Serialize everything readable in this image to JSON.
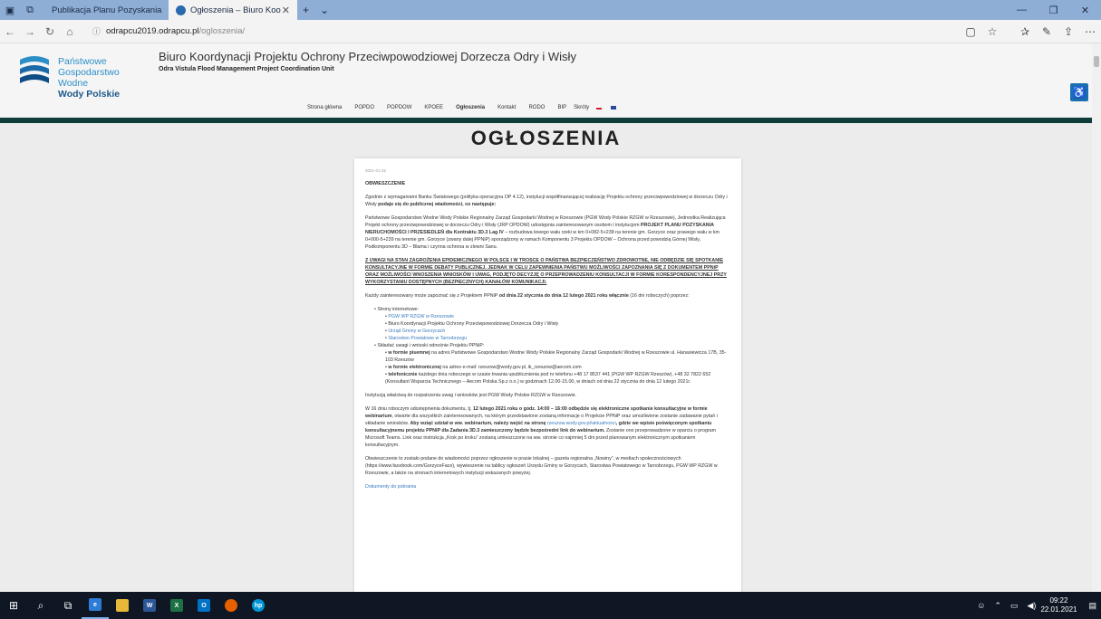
{
  "browser": {
    "tabs": [
      {
        "title": "Publikacja Planu Pozyskania",
        "active": false
      },
      {
        "title": "Ogłoszenia – Biuro Koo",
        "active": true
      }
    ],
    "url_domain": "odrapcu2019.odrapcu.pl",
    "url_path": "/ogloszenia/"
  },
  "site": {
    "logo_line1": "Państwowe",
    "logo_line2": "Gospodarstwo Wodne",
    "logo_line3": "Wody Polskie",
    "title": "Biuro Koordynacji Projektu Ochrony Przeciwpowodziowej Dorzecza Odry i Wisły",
    "subtitle": "Odra Vistula Flood Management Project Coordination Unit",
    "nav": [
      "Strona główna",
      "POPDO",
      "POPDOW",
      "KPOEE",
      "Ogłoszenia",
      "Kontakt",
      "RODO",
      "BIP",
      "Skróty"
    ],
    "heading": "OGŁOSZENIA"
  },
  "article": {
    "date": "2021-01-22",
    "header": "OBWIESZCZENIE",
    "p1": "Zgodnie z wymaganiami Banku Światowego (polityka operacyjna OP 4.12), instytucji współfinansującej realizację Projektu ochrony przeciwpowodziowej w dorzeczu Odry i Wisły ",
    "p1b": "podaje się do publicznej wiadomości, co następuje:",
    "p2": "Państwowe Gospodarstwo Wodne Wody Polskie Regionalny Zarząd Gospodarki Wodnej w Rzeszowie (PGW Wody Polskie RZGW w Rzeszowie), Jednostka Realizująca Projekt ochrony przeciwpowodziowej w dorzeczu Odry i Wisły (JRP OPDOW) udostępnia zainteresowanym osobom i instytucjom ",
    "p2b": "PROJEKT PLANU POZYSKANIA NIERUCHOMOŚCI I PRZESIEDLEŃ dla Kontraktu 3D.3 Lag IV",
    "p2c": " – rozbudowa lewego wału rzeki w km 0+082-5+238 na terenie gm. Gorzyce oraz prawego wału w km 0+000-5+239 na terenie gm. Gorzyce (zwany dalej PPNiP) sporządzony w ramach Komponentu 3 Projektu OPDOW – Ochrona przed powodzią Górnej Wisły, Podkomponentu 3D – Blama i czynna ochrona w zlewni Sanu.",
    "p3": "Z UWAGI NA STAN ZAGROŻENIA EPIDEMICZNEGO W POLSCE I W TROSCE O PAŃSTWA BEZPIECZEŃSTWO ZDROWOTNE, NIE ODBĘDZIE SIĘ SPOTKANIE KONSULTACYJNE W FORMIE DEBATY PUBLICZNEJ. JEDNAK W CELU ZAPEWNIENIA PAŃSTWU MOŻLIWOŚCI ZAPOZNANIA SIĘ Z DOKUMENTEM PPNiP ORAZ MOŻLIWOŚCI WNOSZENIA WNIOSKÓW I UWAG, PODJĘTO DECYZJĘ O PRZEPROWADZENIU KONSULTACJI W FORMIE KORESPONDENCYJNEJ PRZY WYKORZYSTANIU DOSTĘPNYCH (BEZPIECZNYCH) KANAŁÓW KOMUNIKACJI.",
    "p4a": "Każdy zainteresowany może zapoznać się z Projektem PPNiP ",
    "p4b": "od dnia 22 stycznia do dnia 12 lutego 2021 roku włącznie",
    "p4c": " (16 dni roboczych) poprzez:",
    "list_web": "Strony internetowe:",
    "web1": "PGW WP RZGW w Rzeszowie",
    "web2": "Biuro Koordynacji Projektu Ochrony Przeciwpowodziowej Dorzecza Odry i Wisły",
    "web3": "Urząd Gminy w Gorzycach",
    "web4": "Starostwo Powiatowe w Tarnobrzegu",
    "list_submit": "Składać uwagi i wnioski odnośnie Projektu PPNiP:",
    "sub1a": "w formie pisemnej",
    "sub1b": " na adres Państwowe Gospodarstwo Wodne Wody Polskie Regionalny Zarząd Gospodarki Wodnej w Rzeszowie ul. Hanasiewicza 17B, 35-103 Rzeszów",
    "sub2a": "w formie elektronicznej",
    "sub2b": " na adres e-mail: rzeszow@wody.gov.pl, ik_rzeszow@aecom.com",
    "sub3a": "telefonicznie",
    "sub3b": " każdego dnia roboczego w czasie trwania upublicznienia pod nr telefonu +48 17 8537 441 (PGW WP RZGW Rzeszów), +48 32 7822 652 (Konsultant Wsparcia Technicznego – Aecom Polska Sp.z o.o.) w godzinach 12.00-15.00, w dniach od dnia 22 stycznia do dnia 12 lutego 2021r.",
    "p5": "Instytucją właściwą do rozpatrzenia uwag i wniosków jest PGW Wody Polskie RZGW w Rzeszowie.",
    "p6a": "W 16 dniu roboczym udostępnienia dokumentu, tj. ",
    "p6b": "12 lutego 2021 roku o godz. 14:00 – 16:00 odbędzie się elektroniczne spotkanie konsultacyjne w formie webinarium",
    "p6c": ", otwarte dla wszystkich zainteresowanych, na którym przedstawione zostaną informacje o Projekcie PPNiP oraz umożliwione zostanie zadawanie pytań i składanie wniosków. ",
    "p6d": "Aby wziąć udział w ww. webinarium, należy wejść na stronę ",
    "p6link": "rzeszow.wody.gov.pl/aktualnosci",
    "p6e": ", gdzie we wpisie poświęconym spotkaniu konsultacyjnemu projektu PPNiP dla Zadania 3D.3 zamieszczony będzie bezpośredni link do webinarium.",
    "p6f": " Zostanie ono przeprowadzone w oparciu o program Microsoft Teams. Link oraz instrukcja „Krok po kroku” zostaną umieszczone na ww. stronie co najmniej 5 dni przed planowanym elektronicznym spotkaniem konsultacyjnym.",
    "p7": "Obwieszczenie to zostało podane do wiadomości poprzez ogłoszenie w prasie lokalnej – gazeta regionalna „Nowiny”, w mediach społecznościowych (https://www.facebook.com/GorzyceFace), wywieszenie na tablicy ogłoszeń Urzędu Gminy w Gorzycach, Starostwa Powiatowego w Tarnobrzegu, PGW WP RZGW w Rzeszowie, a także na stronach internetowych instytucji wskazanych powyżej.",
    "docs_link": "Dokumenty do pobrania"
  },
  "taskbar": {
    "time": "09:22",
    "date": "22.01.2021"
  }
}
